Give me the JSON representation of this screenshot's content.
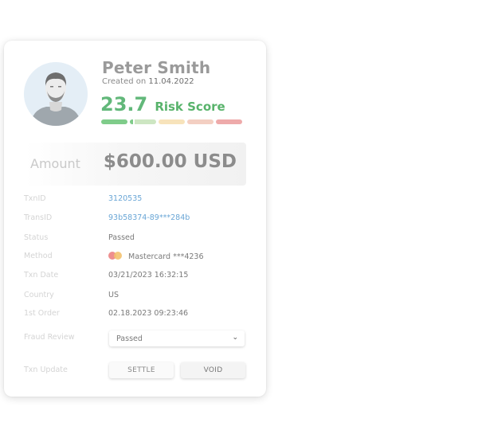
{
  "customer": {
    "name": "Peter Smith",
    "created_prefix": "Created on",
    "created_date": "11.04.2022"
  },
  "risk": {
    "score": "23.7",
    "label": "Risk Score",
    "level_fraction": 0.237,
    "colors": [
      "#7fcc8a",
      "#cde6c2",
      "#f7e3bb",
      "#f3cfc2",
      "#eeaaaa"
    ]
  },
  "amount": {
    "label": "Amount",
    "value": "$600.00 USD"
  },
  "details": [
    {
      "label": "TxnID",
      "value": "3120535",
      "link": true
    },
    {
      "label": "TransID",
      "value": "93b58374-89***284b",
      "link": true
    },
    {
      "label": "Status",
      "value": "Passed",
      "link": false
    },
    {
      "label": "Method",
      "value": "Mastercard ***4236",
      "link": false,
      "icon": "mastercard-icon"
    },
    {
      "label": "Txn Date",
      "value": "03/21/2023 16:32:15",
      "link": false
    },
    {
      "label": "Country",
      "value": "US",
      "link": false
    },
    {
      "label": "1st Order",
      "value": "02.18.2023 09:23:46",
      "link": false
    }
  ],
  "fraud_review": {
    "label": "Fraud Review",
    "selected": "Passed",
    "icon": "chevron-down-icon"
  },
  "txn_update": {
    "label": "Txn Update",
    "settle_label": "SETTLE",
    "void_label": "VOID"
  }
}
